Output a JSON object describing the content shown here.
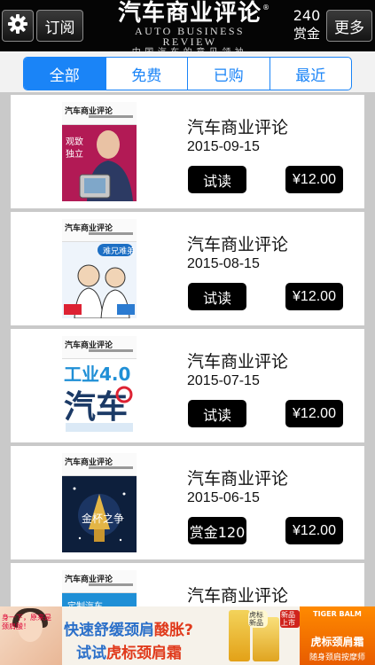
{
  "header": {
    "settings_icon": "gear-icon",
    "subscribe_label": "订阅",
    "brand_cn": "汽车商业评论",
    "brand_en": "AUTO BUSINESS REVIEW",
    "brand_slogan": "中国汽车的意见领袖",
    "reg_mark": "®",
    "coins_count": "240",
    "coins_label": "赏金",
    "more_label": "更多"
  },
  "tabs": [
    {
      "label": "全部",
      "active": true
    },
    {
      "label": "免费",
      "active": false
    },
    {
      "label": "已购",
      "active": false
    },
    {
      "label": "最近",
      "active": false
    }
  ],
  "issues": [
    {
      "title": "汽车商业评论",
      "date": "2015-09-15",
      "action_label": "试读",
      "price": "¥12.00",
      "cover_logo": "汽车商业评论",
      "cover_text": "观致 独立",
      "cover_color": "#b21a55"
    },
    {
      "title": "汽车商业评论",
      "date": "2015-08-15",
      "action_label": "试读",
      "price": "¥12.00",
      "cover_logo": "汽车商业评论",
      "cover_text": "难兄难弟",
      "cover_color": "#eef4fb"
    },
    {
      "title": "汽车商业评论",
      "date": "2015-07-15",
      "action_label": "试读",
      "price": "¥12.00",
      "cover_logo": "汽车商业评论",
      "cover_text": "工业4.0 汽车",
      "cover_color": "#ffffff"
    },
    {
      "title": "汽车商业评论",
      "date": "2015-06-15",
      "action_label": "赏金120",
      "price": "¥12.00",
      "cover_logo": "汽车商业评论",
      "cover_text": "金杯之争",
      "cover_color": "#0d1f3c"
    },
    {
      "title": "汽车商业评论",
      "date": "",
      "action_label": "",
      "price": "",
      "cover_logo": "汽车商业评论",
      "cover_text": "定制汽车",
      "cover_color": "#1f8fd6"
    }
  ],
  "ad": {
    "bubble": "身一下，原来是颈肩酸！",
    "line1_a": "快速舒缓颈肩",
    "line1_b": "酸胀?",
    "line2_a": "试试",
    "line2_b": "虎标颈肩霜",
    "badge1": "虎标新品",
    "badge2": "新品上市",
    "brand_en": "TIGER BALM",
    "brand_cn": "虎标颈肩霜",
    "tag": "随身颈肩按摩师"
  }
}
